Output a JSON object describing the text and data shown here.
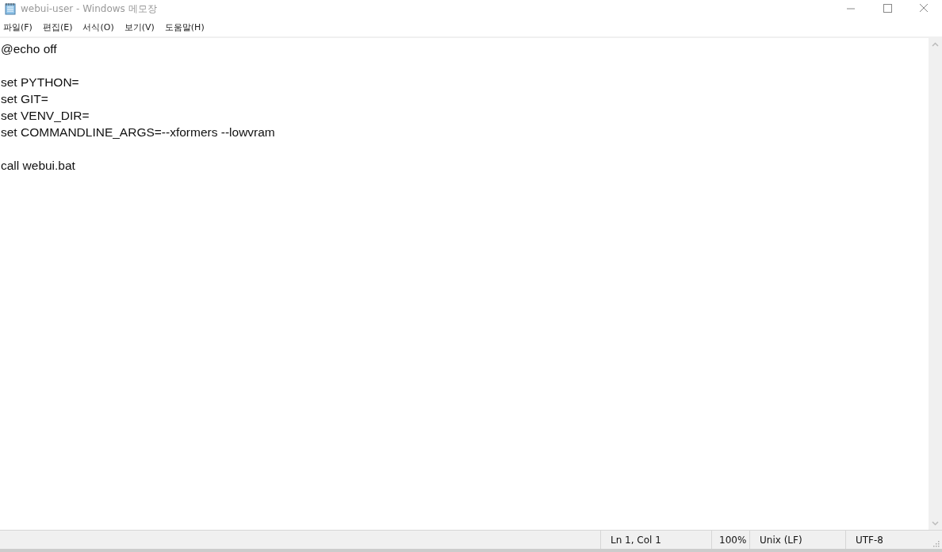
{
  "window": {
    "title": "webui-user - Windows 메모장"
  },
  "menu": [
    "파일(F)",
    "편집(E)",
    "서식(O)",
    "보기(V)",
    "도움말(H)"
  ],
  "editor": {
    "blocks": [
      [
        "@echo off"
      ],
      [
        "set PYTHON=",
        "set GIT=",
        "set VENV_DIR=",
        "set COMMANDLINE_ARGS=--xformers --lowvram"
      ],
      [
        "call webui.bat"
      ]
    ]
  },
  "status_bar": [
    "Ln 1, Col 1",
    "100%",
    "Unix (LF)",
    "UTF-8"
  ]
}
